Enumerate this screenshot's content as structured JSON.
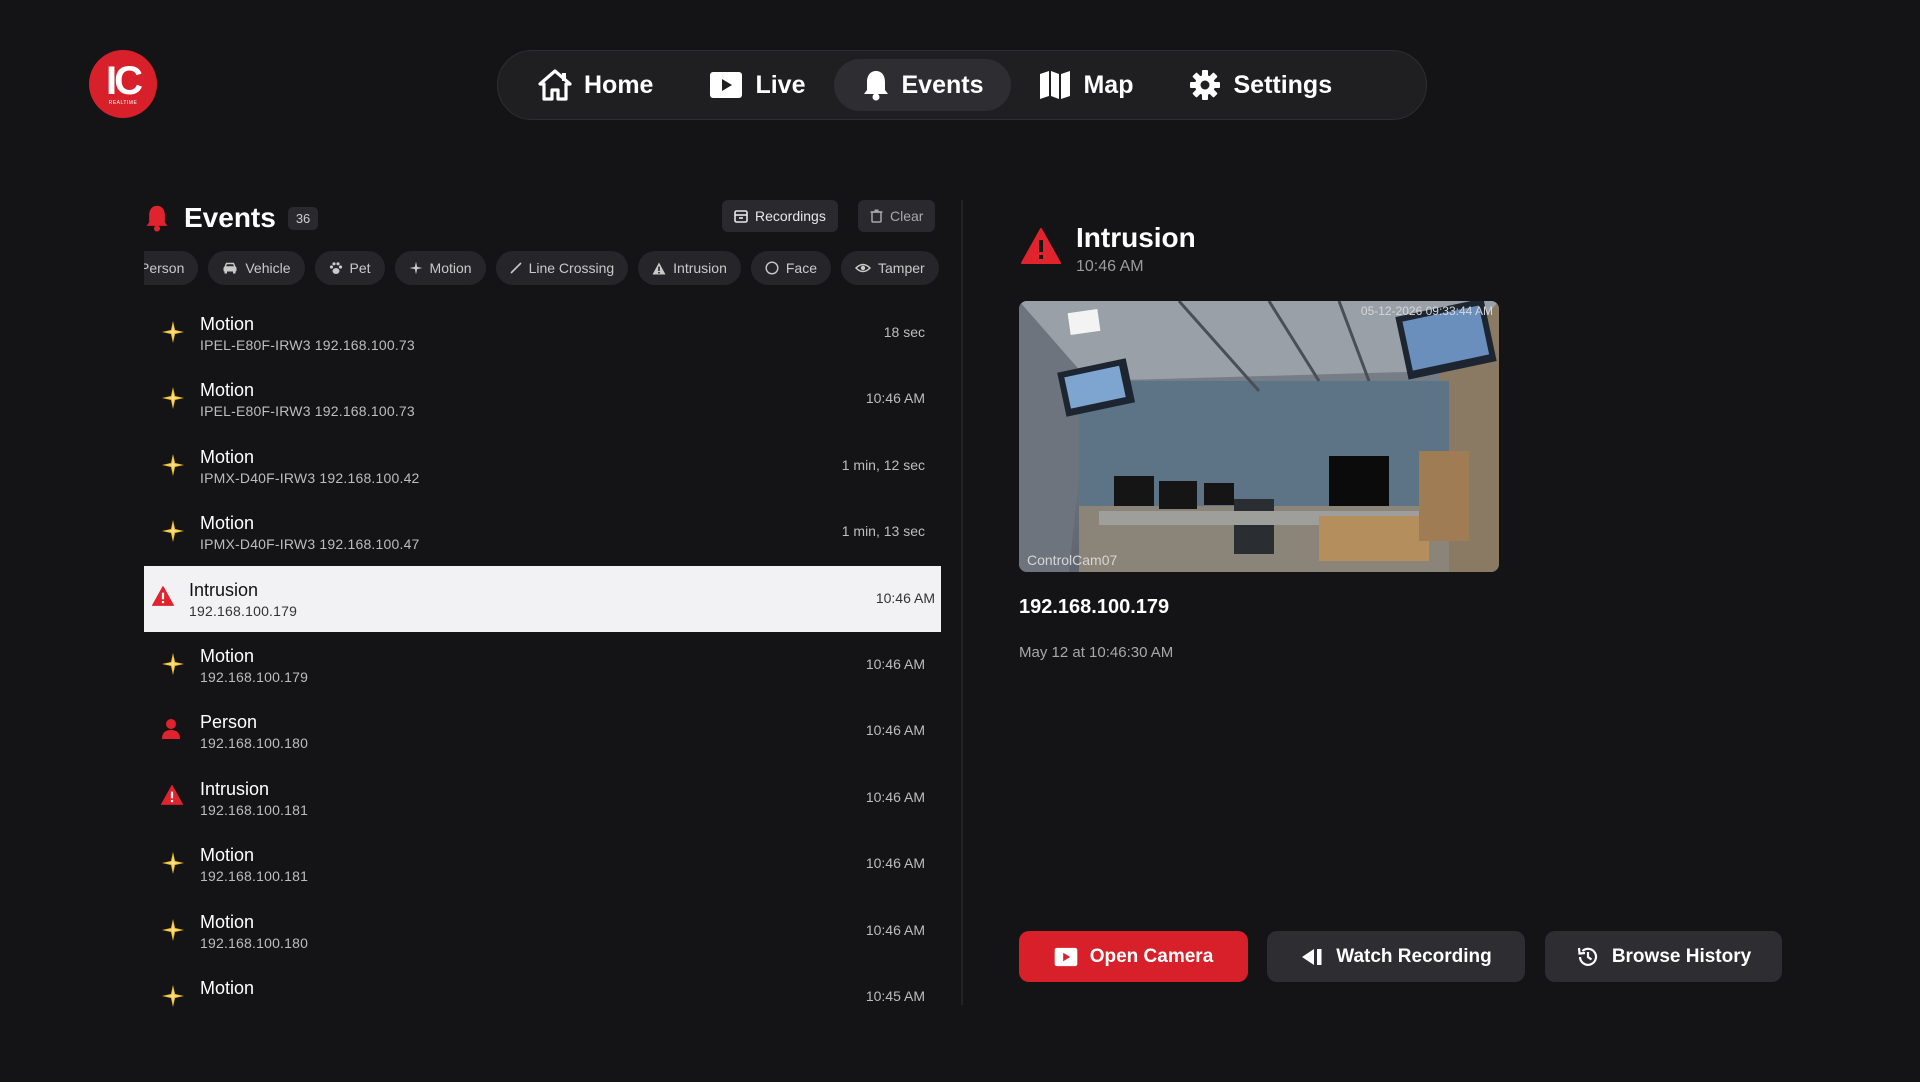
{
  "logo": {
    "text": "IC",
    "subtext": "REALTIME"
  },
  "nav": {
    "items": [
      {
        "label": "Home",
        "icon": "home-icon",
        "active": false
      },
      {
        "label": "Live",
        "icon": "play-icon",
        "active": false
      },
      {
        "label": "Events",
        "icon": "bell-icon",
        "active": true
      },
      {
        "label": "Map",
        "icon": "map-icon",
        "active": false
      },
      {
        "label": "Settings",
        "icon": "gear-icon",
        "active": false
      }
    ]
  },
  "events": {
    "title": "Events",
    "count": "36",
    "recordings_label": "Recordings",
    "clear_label": "Clear",
    "filters": [
      "Person",
      "Vehicle",
      "Pet",
      "Motion",
      "Line Crossing",
      "Intrusion",
      "Face",
      "Tamper"
    ],
    "list": [
      {
        "type": "Motion",
        "subtitle": "IPEL-E80F-IRW3 192.168.100.73",
        "time": "18 sec",
        "icon": "motion"
      },
      {
        "type": "Motion",
        "subtitle": "IPEL-E80F-IRW3 192.168.100.73",
        "time": "10:46 AM",
        "icon": "motion"
      },
      {
        "type": "Motion",
        "subtitle": "IPMX-D40F-IRW3 192.168.100.42",
        "time": "1 min, 12 sec",
        "icon": "motion"
      },
      {
        "type": "Motion",
        "subtitle": "IPMX-D40F-IRW3 192.168.100.47",
        "time": "1 min, 13 sec",
        "icon": "motion"
      },
      {
        "type": "Intrusion",
        "subtitle": "192.168.100.179",
        "time": "10:46 AM",
        "icon": "intrusion",
        "selected": true
      },
      {
        "type": "Motion",
        "subtitle": "192.168.100.179",
        "time": "10:46 AM",
        "icon": "motion"
      },
      {
        "type": "Person",
        "subtitle": "192.168.100.180",
        "time": "10:46 AM",
        "icon": "person"
      },
      {
        "type": "Intrusion",
        "subtitle": "192.168.100.181",
        "time": "10:46 AM",
        "icon": "intrusion"
      },
      {
        "type": "Motion",
        "subtitle": "192.168.100.181",
        "time": "10:46 AM",
        "icon": "motion"
      },
      {
        "type": "Motion",
        "subtitle": "192.168.100.180",
        "time": "10:46 AM",
        "icon": "motion"
      },
      {
        "type": "Motion",
        "subtitle": "",
        "time": "10:45 AM",
        "icon": "motion"
      }
    ]
  },
  "detail": {
    "title": "Intrusion",
    "time": "10:46 AM",
    "snapshot_timestamp": "05-12-2026 09:33:44 AM",
    "snapshot_camera": "ControlCam07",
    "ip": "192.168.100.179",
    "date": "May 12 at 10:46:30 AM"
  },
  "actions": {
    "open_camera": "Open Camera",
    "watch_recording": "Watch Recording",
    "browse_history": "Browse History"
  },
  "colors": {
    "background": "#141416",
    "accent_red": "#d8202a",
    "motion_yellow": "#f2c12e",
    "selected_row": "#f2f2f4"
  }
}
